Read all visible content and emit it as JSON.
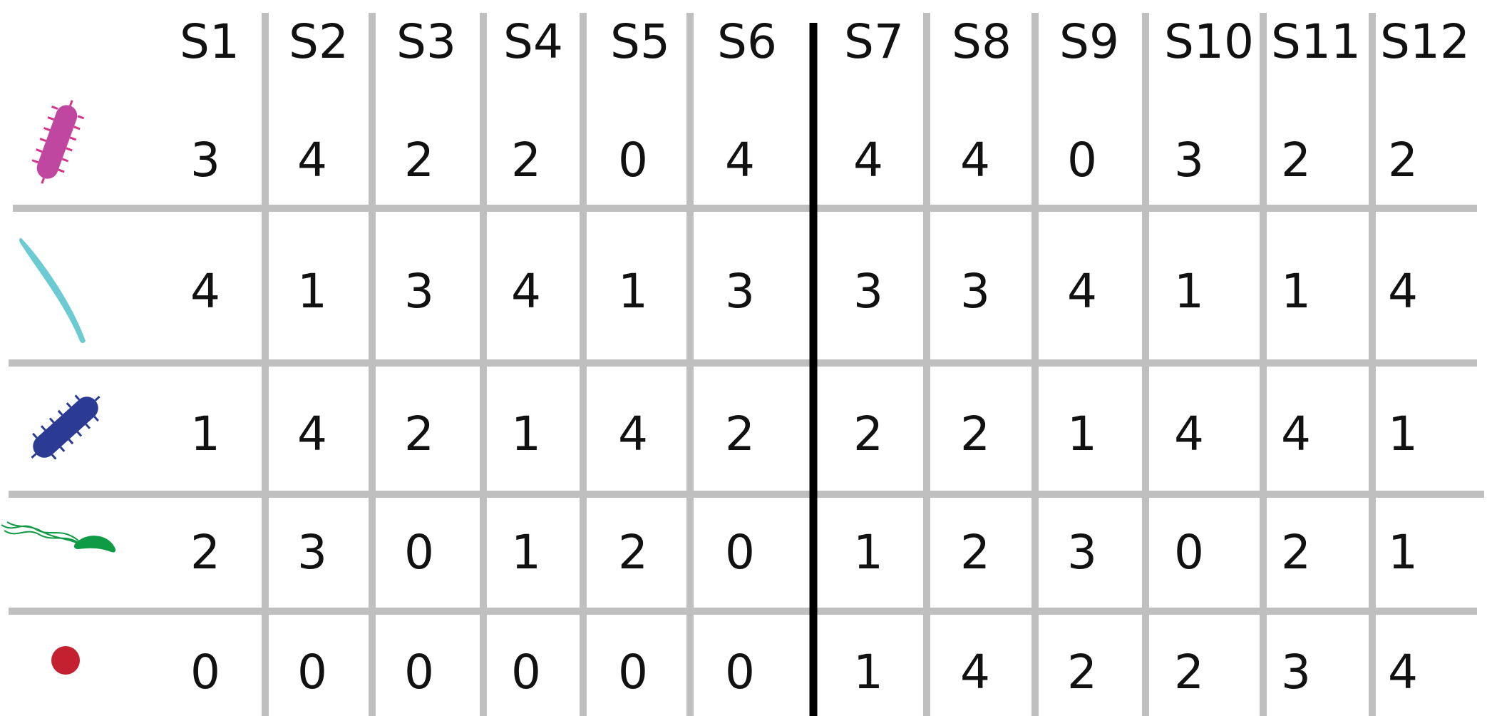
{
  "columns": [
    "S1",
    "S2",
    "S3",
    "S4",
    "S5",
    "S6",
    "S7",
    "S8",
    "S9",
    "S10",
    "S11",
    "S12"
  ],
  "rows": [
    {
      "organism_icon": "pink-rod-bacterium-icon",
      "color": "#c0479f",
      "values": [
        "3",
        "4",
        "2",
        "2",
        "0",
        "4",
        "4",
        "4",
        "0",
        "3",
        "2",
        "2"
      ]
    },
    {
      "organism_icon": "cyan-curved-rod-bacterium-icon",
      "color": "#6ccad2",
      "values": [
        "4",
        "1",
        "3",
        "4",
        "1",
        "3",
        "3",
        "3",
        "4",
        "1",
        "1",
        "4"
      ]
    },
    {
      "organism_icon": "blue-rod-bacterium-icon",
      "color": "#2b3a93",
      "values": [
        "1",
        "4",
        "2",
        "1",
        "4",
        "2",
        "2",
        "2",
        "1",
        "4",
        "4",
        "1"
      ]
    },
    {
      "organism_icon": "green-flagellated-bacterium-icon",
      "color": "#0f9a46",
      "values": [
        "2",
        "3",
        "0",
        "1",
        "2",
        "0",
        "1",
        "2",
        "3",
        "0",
        "2",
        "1"
      ]
    },
    {
      "organism_icon": "red-coccus-icon",
      "color": "#c32030",
      "values": [
        "0",
        "0",
        "0",
        "0",
        "0",
        "0",
        "1",
        "4",
        "2",
        "2",
        "3",
        "4"
      ]
    }
  ],
  "colors": {
    "grid_line": "#bfbfbf",
    "divider": "#000000"
  }
}
